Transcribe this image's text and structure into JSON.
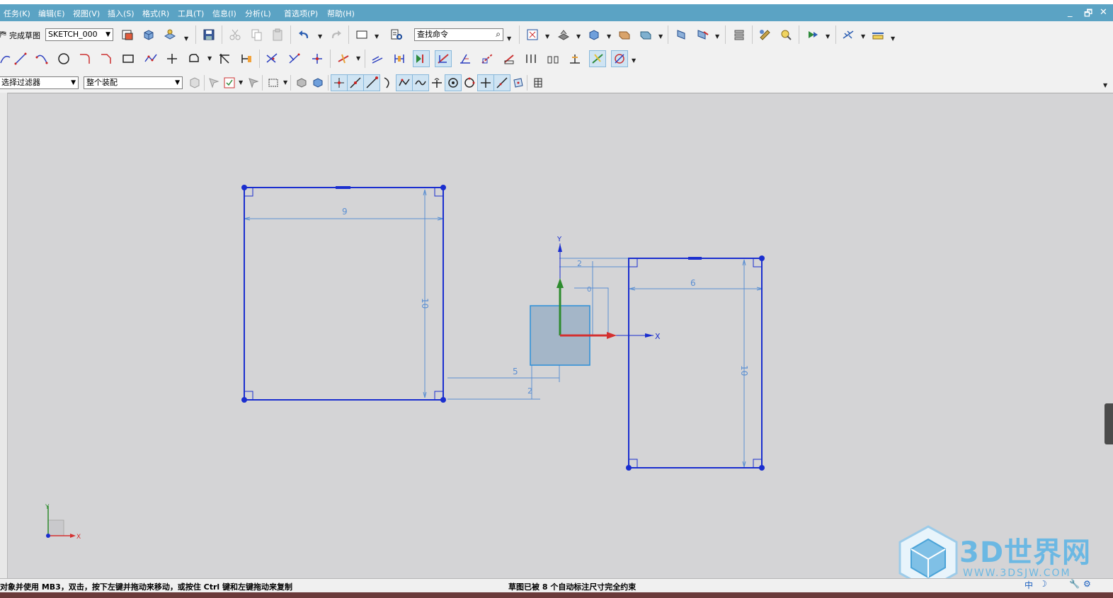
{
  "menu": {
    "items": [
      "任务(K)",
      "编辑(E)",
      "视图(V)",
      "插入(S)",
      "格式(R)",
      "工具(T)",
      "信息(I)",
      "分析(L)",
      "首选项(P)",
      "帮助(H)"
    ],
    "window_controls": [
      "_",
      "🗗",
      "✕"
    ]
  },
  "toolbar": {
    "finish_sketch_label": "完成草图",
    "sketch_name": "SKETCH_000",
    "find_command_placeholder": "查找命令",
    "selection_filter": "选择过滤器",
    "assembly_scope": "整个装配"
  },
  "sketch": {
    "left_rect": {
      "width_dim": "9",
      "height_dim": "10"
    },
    "right_rect": {
      "width_dim": "6",
      "height_dim": "10"
    },
    "offset_dims": [
      "5",
      "2",
      "2",
      "0"
    ],
    "axis_labels": {
      "x": "X",
      "y": "Y"
    }
  },
  "triad": {
    "x": "X",
    "y": "Y"
  },
  "status": {
    "left": "对象并使用 MB3，双击，按下左键并拖动来移动，或按住 Ctrl 键和左键拖动来复制",
    "right": "草图已被 8 个自动标注尺寸完全约束"
  },
  "watermark": {
    "title": "3D世界网",
    "url": "WWW.3DSJW.COM"
  },
  "tray": {
    "ime": "中"
  },
  "colors": {
    "menubar": "#5ba3c4",
    "canvas": "#d4d4d6",
    "curve": "#1a2ecf",
    "dimension": "#5b8fd2"
  }
}
